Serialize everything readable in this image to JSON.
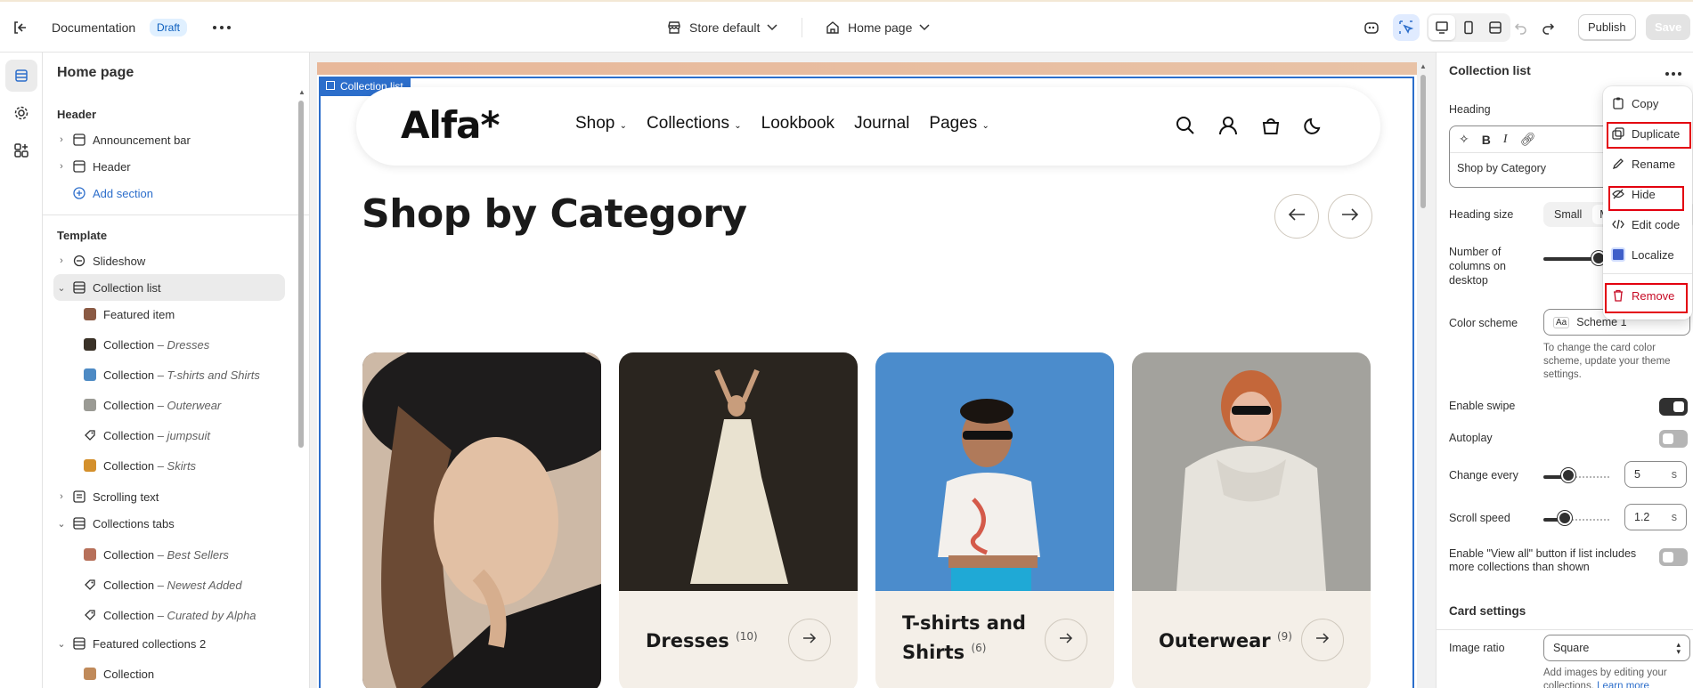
{
  "topbar": {
    "doc_title": "Documentation",
    "status_badge": "Draft",
    "store": "Store default",
    "page": "Home page",
    "publish": "Publish",
    "save": "Save"
  },
  "left": {
    "title": "Home page",
    "header_group": "Header",
    "header_items": [
      {
        "label": "Announcement bar"
      },
      {
        "label": "Header"
      }
    ],
    "add_section": "Add section",
    "template_group": "Template",
    "items": [
      {
        "label": "Slideshow"
      },
      {
        "label": "Collection list"
      },
      {
        "label": "Featured item"
      },
      {
        "label": "Collection",
        "sub": "– Dresses"
      },
      {
        "label": "Collection",
        "sub": "– T-shirts and Shirts"
      },
      {
        "label": "Collection",
        "sub": "– Outerwear"
      },
      {
        "label": "Collection",
        "sub": "– jumpsuit"
      },
      {
        "label": "Collection",
        "sub": "– Skirts"
      },
      {
        "label": "Scrolling text"
      },
      {
        "label": "Collections tabs"
      },
      {
        "label": "Collection",
        "sub": "– Best Sellers"
      },
      {
        "label": "Collection",
        "sub": "– Newest Added"
      },
      {
        "label": "Collection",
        "sub": "– Curated by Alpha"
      },
      {
        "label": "Featured collections 2"
      },
      {
        "label": "Collection"
      }
    ]
  },
  "preview": {
    "section_tag": "Collection list",
    "logo": "Alfa*",
    "nav": [
      {
        "label": "Shop"
      },
      {
        "label": "Collections"
      },
      {
        "label": "Lookbook"
      },
      {
        "label": "Journal"
      },
      {
        "label": "Pages"
      }
    ],
    "heading": "Shop by Category",
    "cards": [
      {
        "name": "",
        "count": ""
      },
      {
        "name": "Dresses",
        "count": "(10)"
      },
      {
        "name": "T-shirts and Shirts",
        "line1": "T-shirts and",
        "line2": "Shirts",
        "count": "(6)"
      },
      {
        "name": "Outerwear",
        "count": "(9)"
      }
    ]
  },
  "right": {
    "title": "Collection list",
    "heading_label": "Heading",
    "heading_value": "Shop by Category",
    "heading_size_label": "Heading size",
    "heading_size_options": [
      "Small",
      "M"
    ],
    "columns_label": "Number of columns on desktop",
    "color_scheme_label": "Color scheme",
    "color_scheme_value": "Scheme 1",
    "color_scheme_help": "To change the card color scheme, update your theme settings.",
    "enable_swipe": "Enable swipe",
    "autoplay": "Autoplay",
    "change_every": "Change every",
    "change_every_value": "5",
    "change_every_unit": "s",
    "scroll_speed": "Scroll speed",
    "scroll_speed_value": "1.2",
    "scroll_speed_unit": "s",
    "view_all": "Enable \"View all\" button if list includes more collections than shown",
    "card_settings": "Card settings",
    "image_ratio_label": "Image ratio",
    "image_ratio_value": "Square",
    "image_ratio_help": "Add images by editing your collections.",
    "learn_more": "Learn more"
  },
  "context_menu": [
    {
      "label": "Copy"
    },
    {
      "label": "Duplicate"
    },
    {
      "label": "Rename"
    },
    {
      "label": "Hide"
    },
    {
      "label": "Edit code"
    },
    {
      "label": "Localize"
    },
    {
      "label": "Remove"
    }
  ],
  "colors": {
    "accent": "#2c6ecb",
    "highlight": "#e3000f",
    "danger": "#c70a24",
    "badge_bg": "#e0f0ff"
  }
}
